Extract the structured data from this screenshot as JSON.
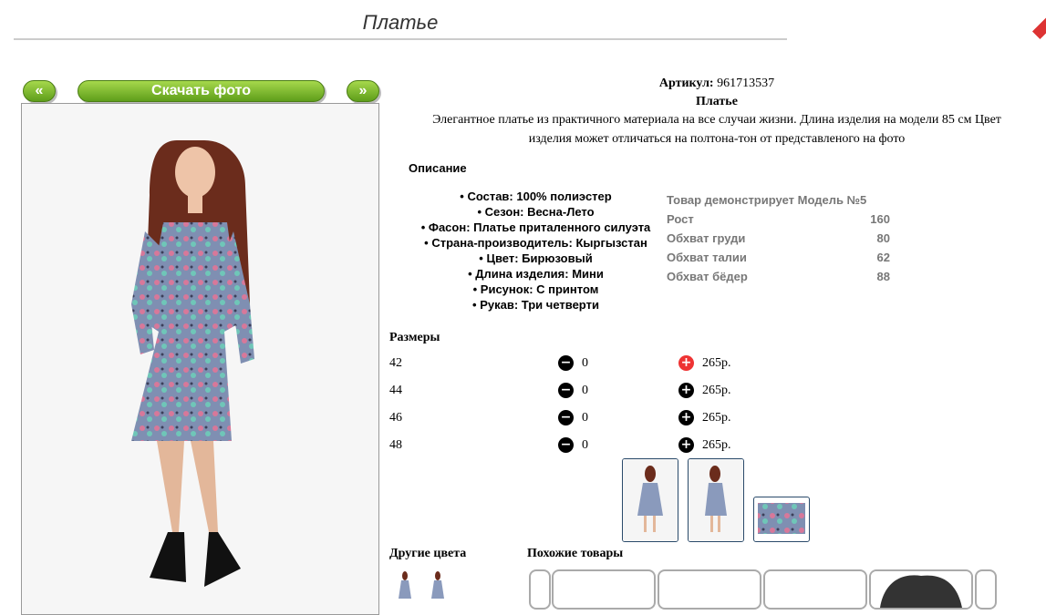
{
  "page": {
    "title": "Платье"
  },
  "gallery": {
    "prev_label": "«",
    "download_label": "Скачать фото",
    "next_label": "»"
  },
  "product": {
    "article_label": "Артикул:",
    "article_value": "961713537",
    "name": "Платье",
    "summary_line1": "Элегантное платье из практичного материала на все случаи жизни. Длина изделия на модели 85 см Цвет",
    "summary_line2": "изделия может отличаться на полтона-тон от представленого на фото"
  },
  "description": {
    "heading": "Описание",
    "attributes": [
      "Состав: 100% полиэстер",
      "Сезон: Весна-Лето",
      "Фасон: Платье приталенного силуэта",
      "Страна-производитель: Кыргызстан",
      "Цвет: Бирюзовый",
      "Длина изделия: Мини",
      "Рисунок: С принтом",
      "Рукав: Три четверти"
    ]
  },
  "model": {
    "header": "Товар демонстрирует Модель №5",
    "rows": [
      {
        "label": "Рост",
        "value": "160"
      },
      {
        "label": "Обхват груди",
        "value": "80"
      },
      {
        "label": "Обхват талии",
        "value": "62"
      },
      {
        "label": "Обхват бёдер",
        "value": "88"
      }
    ]
  },
  "sizes": {
    "heading": "Размеры",
    "rows": [
      {
        "size": "42",
        "qty": "0",
        "price": "265р."
      },
      {
        "size": "44",
        "qty": "0",
        "price": "265р."
      },
      {
        "size": "46",
        "qty": "0",
        "price": "265р."
      },
      {
        "size": "48",
        "qty": "0",
        "price": "265р."
      }
    ],
    "minus_icon": "−",
    "plus_icon": "+"
  },
  "colors": {
    "accent_green": "#6aaa22",
    "plus_active": "#e33333"
  },
  "other_colors_heading": "Другие цвета",
  "similar_heading": "Похожие товары"
}
